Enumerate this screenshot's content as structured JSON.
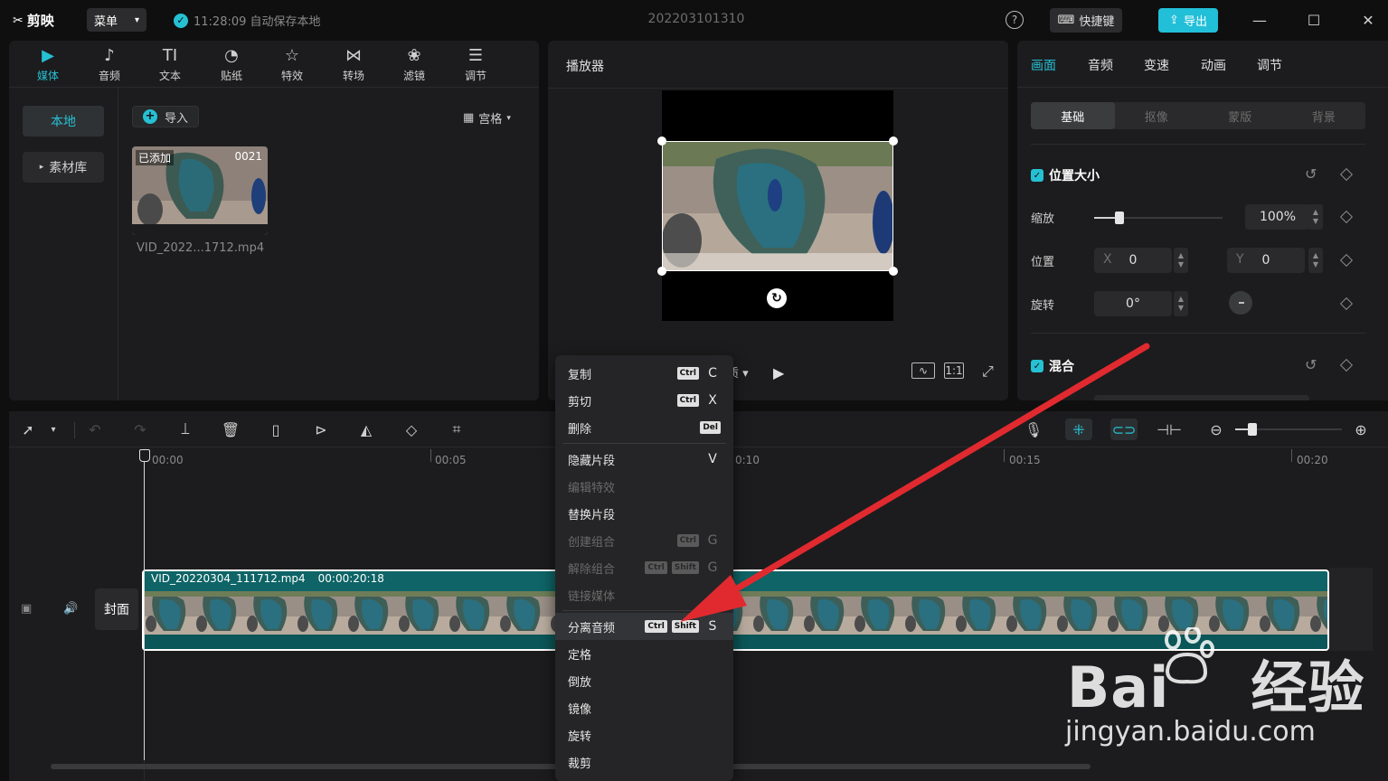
{
  "titlebar": {
    "app_name": "剪映",
    "menu_label": "菜单",
    "save_status": "11:28:09 自动保存本地",
    "project_title": "202203101310",
    "help": "?",
    "shortcut_label": "快捷键",
    "export_label": "导出"
  },
  "media_panel": {
    "tabs": [
      {
        "label": "媒体",
        "icon": "media-icon"
      },
      {
        "label": "音频",
        "icon": "audio-icon"
      },
      {
        "label": "文本",
        "icon": "text-icon"
      },
      {
        "label": "贴纸",
        "icon": "sticker-icon"
      },
      {
        "label": "特效",
        "icon": "effects-icon"
      },
      {
        "label": "转场",
        "icon": "transition-icon"
      },
      {
        "label": "滤镜",
        "icon": "filter-icon"
      },
      {
        "label": "调节",
        "icon": "adjust-icon"
      }
    ],
    "text_tab_glyph": "TI",
    "local_label": "本地",
    "library_label": "素材库",
    "import_label": "导入",
    "view_label": "宫格",
    "thumb": {
      "added": "已添加",
      "duration": "0021",
      "filename": "VID_2022...1712.mp4"
    }
  },
  "player": {
    "title": "播放器",
    "quality_suffix": "质",
    "ratio_label": "1:1"
  },
  "properties": {
    "tabs": [
      "画面",
      "音频",
      "变速",
      "动画",
      "调节"
    ],
    "subtabs": [
      "基础",
      "抠像",
      "蒙版",
      "背景"
    ],
    "section_position": "位置大小",
    "scale_label": "缩放",
    "scale_value": "100%",
    "position_label": "位置",
    "x_label": "X",
    "x_value": "0",
    "y_label": "Y",
    "y_value": "0",
    "rotate_label": "旋转",
    "rotate_value": "0°",
    "section_blend": "混合",
    "scale_level": 0.2
  },
  "timeline": {
    "ruler": [
      "00:00",
      "00:05",
      "00:10",
      "00:15",
      "00:20"
    ],
    "ruler_partial_10": "0:10",
    "clip_name": "VID_20220304_111712.mp4",
    "clip_duration": "00:00:20:18",
    "cover_label": "封面"
  },
  "context_menu": {
    "items": [
      {
        "label": "复制",
        "keys": [
          "Ctrl"
        ],
        "letter": "C",
        "disabled": false
      },
      {
        "label": "剪切",
        "keys": [
          "Ctrl"
        ],
        "letter": "X",
        "disabled": false
      },
      {
        "label": "删除",
        "keys": [
          "Del"
        ],
        "letter": "",
        "disabled": false
      },
      {
        "label": "隐藏片段",
        "keys": [],
        "letter": "V",
        "disabled": false
      },
      {
        "label": "编辑特效",
        "keys": [],
        "letter": "",
        "disabled": true
      },
      {
        "label": "替换片段",
        "keys": [],
        "letter": "",
        "disabled": false
      },
      {
        "label": "创建组合",
        "keys": [
          "Ctrl"
        ],
        "letter": "G",
        "disabled": true
      },
      {
        "label": "解除组合",
        "keys": [
          "Ctrl",
          "Shift"
        ],
        "letter": "G",
        "disabled": true
      },
      {
        "label": "链接媒体",
        "keys": [],
        "letter": "",
        "disabled": true
      },
      {
        "label": "分离音频",
        "keys": [
          "Ctrl",
          "Shift"
        ],
        "letter": "S",
        "disabled": false,
        "highlighted": true
      },
      {
        "label": "定格",
        "keys": [],
        "letter": "",
        "disabled": false
      },
      {
        "label": "倒放",
        "keys": [],
        "letter": "",
        "disabled": false
      },
      {
        "label": "镜像",
        "keys": [],
        "letter": "",
        "disabled": false
      },
      {
        "label": "旋转",
        "keys": [],
        "letter": "",
        "disabled": false
      },
      {
        "label": "裁剪",
        "keys": [],
        "letter": "",
        "disabled": false
      }
    ]
  },
  "watermark": {
    "brand": "Bai",
    "brand_cn": "经验",
    "url": "jingyan.baidu.com"
  },
  "colors": {
    "accent": "#26c0d3",
    "arrow": "#e02a2f",
    "clip": "#0e6466"
  }
}
